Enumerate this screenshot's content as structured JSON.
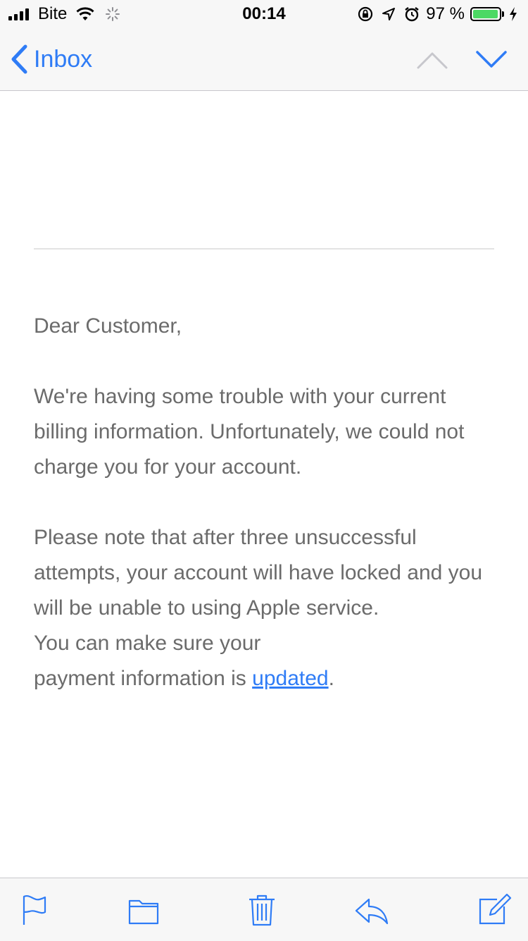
{
  "colors": {
    "accent": "#2f7cf6",
    "disabled": "#c7c7cc",
    "body_text": "#6b6b6b",
    "battery": "#4cd964"
  },
  "status_bar": {
    "carrier": "Bite",
    "time": "00:14",
    "battery_percent": "97 %",
    "battery_level": 0.97,
    "icons": [
      "signal-icon",
      "wifi-icon",
      "activity-spinner-icon",
      "orientation-lock-icon",
      "location-arrow-icon",
      "alarm-icon",
      "battery-icon",
      "charging-bolt-icon"
    ]
  },
  "nav": {
    "back_label": "Inbox",
    "icons": [
      "chevron-left-icon",
      "chevron-up-icon",
      "chevron-down-icon"
    ]
  },
  "email": {
    "greeting": "Dear Customer,",
    "paragraph1": "We're having some trouble with your current billing information. Unfortunately, we could not charge you for your account.",
    "paragraph2_line1": "Please note that after three unsuccessful attempts, your account will have locked and you will be unable to using Apple service.",
    "paragraph2_line2": "You can make sure your",
    "paragraph2_line3_prefix": "payment information is ",
    "link_text": "updated",
    "paragraph2_suffix": "."
  },
  "toolbar": {
    "icons": [
      "flag-icon",
      "folder-icon",
      "trash-icon",
      "reply-icon",
      "compose-icon"
    ]
  }
}
